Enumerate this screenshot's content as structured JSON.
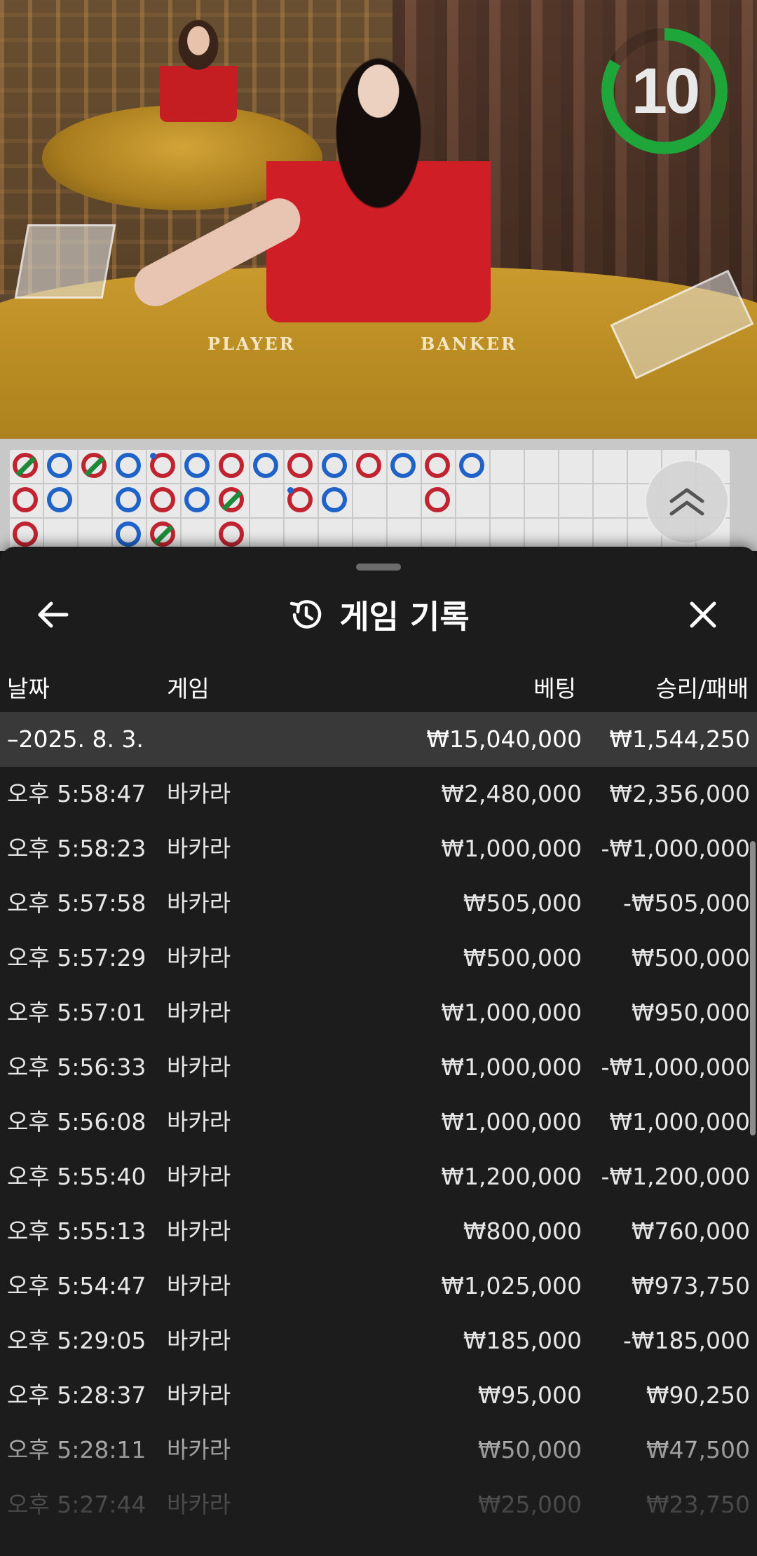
{
  "video": {
    "countdown": "10",
    "table_player_text": "PLAYER",
    "table_banker_text": "BANKER"
  },
  "colors": {
    "banker_red": "#c02430",
    "player_blue": "#1f63c9",
    "tie_green": "#1c8a3a",
    "timer_green": "#1fa63b",
    "sheet_bg": "#1c1c1c",
    "date_row_bg": "#393939"
  },
  "roadmap": {
    "icons": [
      "chevron-double-up-icon"
    ]
  },
  "header": {
    "title": "게임 기록",
    "back_icon": "arrow-left-icon",
    "history_icon": "history-clock-icon",
    "close_icon": "close-icon"
  },
  "columns": {
    "date": "날짜",
    "game": "게임",
    "bet": "베팅",
    "result": "승리/패배"
  },
  "summary": {
    "date": "–2025. 8. 3.",
    "bet": "₩15,040,000",
    "result": "₩1,544,250"
  },
  "rows": [
    {
      "time": "오후 5:58:47",
      "game": "바카라",
      "bet": "₩2,480,000",
      "result": "₩2,356,000"
    },
    {
      "time": "오후 5:58:23",
      "game": "바카라",
      "bet": "₩1,000,000",
      "result": "-₩1,000,000"
    },
    {
      "time": "오후 5:57:58",
      "game": "바카라",
      "bet": "₩505,000",
      "result": "-₩505,000"
    },
    {
      "time": "오후 5:57:29",
      "game": "바카라",
      "bet": "₩500,000",
      "result": "₩500,000"
    },
    {
      "time": "오후 5:57:01",
      "game": "바카라",
      "bet": "₩1,000,000",
      "result": "₩950,000"
    },
    {
      "time": "오후 5:56:33",
      "game": "바카라",
      "bet": "₩1,000,000",
      "result": "-₩1,000,000"
    },
    {
      "time": "오후 5:56:08",
      "game": "바카라",
      "bet": "₩1,000,000",
      "result": "₩1,000,000"
    },
    {
      "time": "오후 5:55:40",
      "game": "바카라",
      "bet": "₩1,200,000",
      "result": "-₩1,200,000"
    },
    {
      "time": "오후 5:55:13",
      "game": "바카라",
      "bet": "₩800,000",
      "result": "₩760,000"
    },
    {
      "time": "오후 5:54:47",
      "game": "바카라",
      "bet": "₩1,025,000",
      "result": "₩973,750"
    },
    {
      "time": "오후 5:29:05",
      "game": "바카라",
      "bet": "₩185,000",
      "result": "-₩185,000"
    },
    {
      "time": "오후 5:28:37",
      "game": "바카라",
      "bet": "₩95,000",
      "result": "₩90,250"
    },
    {
      "time": "오후 5:28:11",
      "game": "바카라",
      "bet": "₩50,000",
      "result": "₩47,500"
    },
    {
      "time": "오후 5:27:44",
      "game": "바카라",
      "bet": "₩25,000",
      "result": "₩23,750"
    }
  ]
}
